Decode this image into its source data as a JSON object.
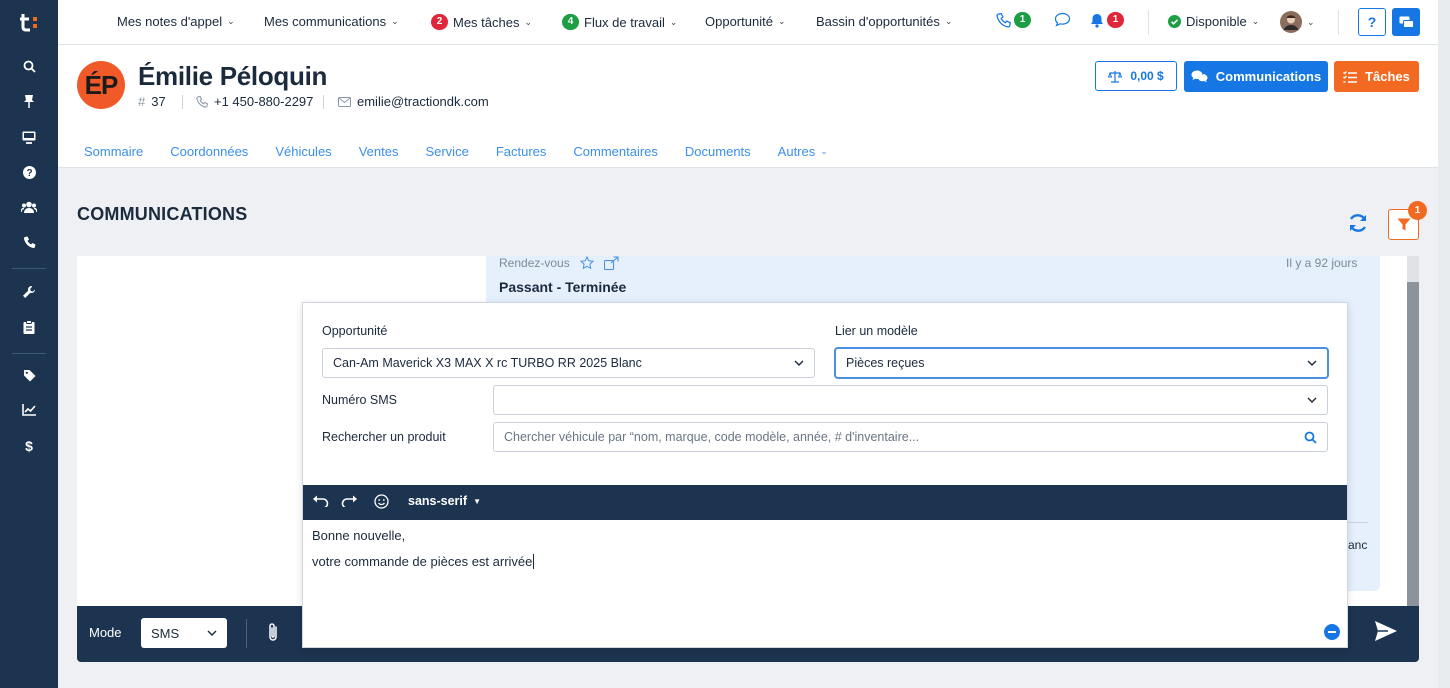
{
  "colors": {
    "navy": "#1c3450",
    "blue": "#1677e4",
    "orange": "#f26a21",
    "red": "#e0263a",
    "green": "#1d9e44"
  },
  "topnav": {
    "call_notes": "Mes notes d'appel",
    "communications": "Mes communications",
    "tasks_count": "2",
    "tasks": "Mes tâches",
    "workflow_count": "4",
    "workflow": "Flux de travail",
    "opportunity": "Opportunité",
    "opportunity_pool": "Bassin d'opportunités",
    "phone_count": "1",
    "notif_count": "1",
    "status": "Disponible",
    "help": "?"
  },
  "client": {
    "initials": "ÉP",
    "name": "Émilie Péloquin",
    "id": "37",
    "phone": "+1 450-880-2297",
    "email": "emilie@tractiondk.com"
  },
  "header_buttons": {
    "balance": "0,00 $",
    "communications": "Communications",
    "tasks": "Tâches"
  },
  "tabs": [
    "Sommaire",
    "Coordonnées",
    "Véhicules",
    "Ventes",
    "Service",
    "Factures",
    "Commentaires",
    "Documents",
    "Autres"
  ],
  "section": {
    "title": "COMMUNICATIONS",
    "filter_count": "1"
  },
  "message": {
    "type": "Rendez-vous",
    "ago": "Il y a 92 jours",
    "title": "Passant - Terminée",
    "tail": "anc"
  },
  "compose": {
    "opportunity_label": "Opportunité",
    "opportunity_value": "Can-Am Maverick X3 MAX X rc TURBO RR 2025 Blanc",
    "template_label": "Lier un modèle",
    "template_value": "Pièces reçues",
    "sms_label": "Numéro SMS",
    "sms_value": "",
    "product_label": "Rechercher un produit",
    "product_placeholder": "Chercher véhicule par “nom, marque, code modèle, année, # d'inventaire...",
    "font": "sans-serif",
    "body_line1": "Bonne nouvelle,",
    "body_line2": "votre commande de pièces est arrivée"
  },
  "bottom": {
    "mode_label": "Mode",
    "mode_value": "SMS"
  },
  "icons": [
    "logo-icon",
    "search-icon",
    "pin-icon",
    "desktop-icon",
    "question-icon",
    "users-icon",
    "phone-icon",
    "wrench-icon",
    "clipboard-icon",
    "tag-icon",
    "chart-icon",
    "dollar-icon",
    "phone-icon",
    "chat-icon",
    "bell-icon",
    "check-circle-icon",
    "user-avatar",
    "chat-bubbles-icon",
    "scale-icon",
    "tasks-icon",
    "refresh-icon",
    "filter-icon",
    "star-icon",
    "external-link-icon",
    "undo-icon",
    "redo-icon",
    "emoji-icon",
    "paperclip-icon",
    "send-icon",
    "minus-icon"
  ]
}
